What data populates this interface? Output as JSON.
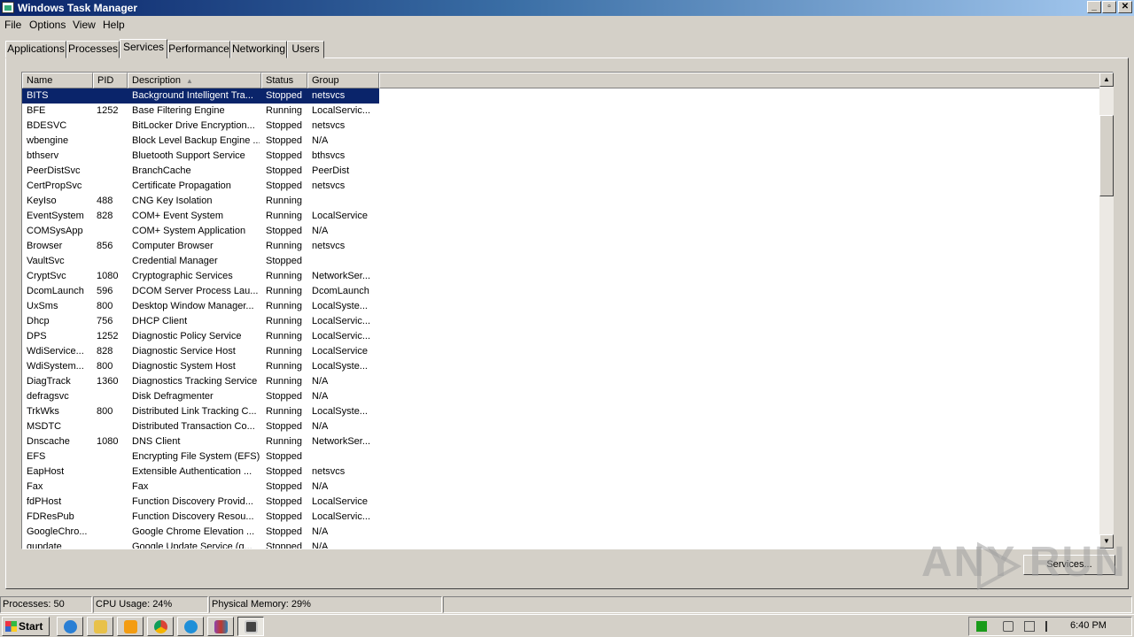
{
  "window": {
    "title": "Windows Task Manager"
  },
  "menu": [
    "File",
    "Options",
    "View",
    "Help"
  ],
  "tabs": [
    "Applications",
    "Processes",
    "Services",
    "Performance",
    "Networking",
    "Users"
  ],
  "active_tab": "Services",
  "columns": [
    "Name",
    "PID",
    "Description",
    "Status",
    "Group"
  ],
  "rows": [
    [
      "BITS",
      "",
      "Background Intelligent Tra...",
      "Stopped",
      "netsvcs"
    ],
    [
      "BFE",
      "1252",
      "Base Filtering Engine",
      "Running",
      "LocalServic..."
    ],
    [
      "BDESVC",
      "",
      "BitLocker Drive Encryption...",
      "Stopped",
      "netsvcs"
    ],
    [
      "wbengine",
      "",
      "Block Level Backup Engine ...",
      "Stopped",
      "N/A"
    ],
    [
      "bthserv",
      "",
      "Bluetooth Support Service",
      "Stopped",
      "bthsvcs"
    ],
    [
      "PeerDistSvc",
      "",
      "BranchCache",
      "Stopped",
      "PeerDist"
    ],
    [
      "CertPropSvc",
      "",
      "Certificate Propagation",
      "Stopped",
      "netsvcs"
    ],
    [
      "KeyIso",
      "488",
      "CNG Key Isolation",
      "Running",
      ""
    ],
    [
      "EventSystem",
      "828",
      "COM+ Event System",
      "Running",
      "LocalService"
    ],
    [
      "COMSysApp",
      "",
      "COM+ System Application",
      "Stopped",
      "N/A"
    ],
    [
      "Browser",
      "856",
      "Computer Browser",
      "Running",
      "netsvcs"
    ],
    [
      "VaultSvc",
      "",
      "Credential Manager",
      "Stopped",
      ""
    ],
    [
      "CryptSvc",
      "1080",
      "Cryptographic Services",
      "Running",
      "NetworkSer..."
    ],
    [
      "DcomLaunch",
      "596",
      "DCOM Server Process Lau...",
      "Running",
      "DcomLaunch"
    ],
    [
      "UxSms",
      "800",
      "Desktop Window Manager...",
      "Running",
      "LocalSyste..."
    ],
    [
      "Dhcp",
      "756",
      "DHCP Client",
      "Running",
      "LocalServic..."
    ],
    [
      "DPS",
      "1252",
      "Diagnostic Policy Service",
      "Running",
      "LocalServic..."
    ],
    [
      "WdiService...",
      "828",
      "Diagnostic Service Host",
      "Running",
      "LocalService"
    ],
    [
      "WdiSystem...",
      "800",
      "Diagnostic System Host",
      "Running",
      "LocalSyste..."
    ],
    [
      "DiagTrack",
      "1360",
      "Diagnostics Tracking Service",
      "Running",
      "N/A"
    ],
    [
      "defragsvc",
      "",
      "Disk Defragmenter",
      "Stopped",
      "N/A"
    ],
    [
      "TrkWks",
      "800",
      "Distributed Link Tracking C...",
      "Running",
      "LocalSyste..."
    ],
    [
      "MSDTC",
      "",
      "Distributed Transaction Co...",
      "Stopped",
      "N/A"
    ],
    [
      "Dnscache",
      "1080",
      "DNS Client",
      "Running",
      "NetworkSer..."
    ],
    [
      "EFS",
      "",
      "Encrypting File System (EFS)",
      "Stopped",
      ""
    ],
    [
      "EapHost",
      "",
      "Extensible Authentication ...",
      "Stopped",
      "netsvcs"
    ],
    [
      "Fax",
      "",
      "Fax",
      "Stopped",
      "N/A"
    ],
    [
      "fdPHost",
      "",
      "Function Discovery Provid...",
      "Stopped",
      "LocalService"
    ],
    [
      "FDResPub",
      "",
      "Function Discovery Resou...",
      "Stopped",
      "LocalServic..."
    ],
    [
      "GoogleChro...",
      "",
      "Google Chrome Elevation ...",
      "Stopped",
      "N/A"
    ],
    [
      "gupdate",
      "",
      "Google Update Service (g...",
      "Stopped",
      "N/A"
    ]
  ],
  "services_button": "Services...",
  "watermark": "ANY RUN",
  "status": {
    "processes": "Processes: 50",
    "cpu": "CPU Usage: 24%",
    "memory": "Physical Memory: 29%"
  },
  "taskbar": {
    "start": "Start",
    "clock": "6:40 PM"
  }
}
